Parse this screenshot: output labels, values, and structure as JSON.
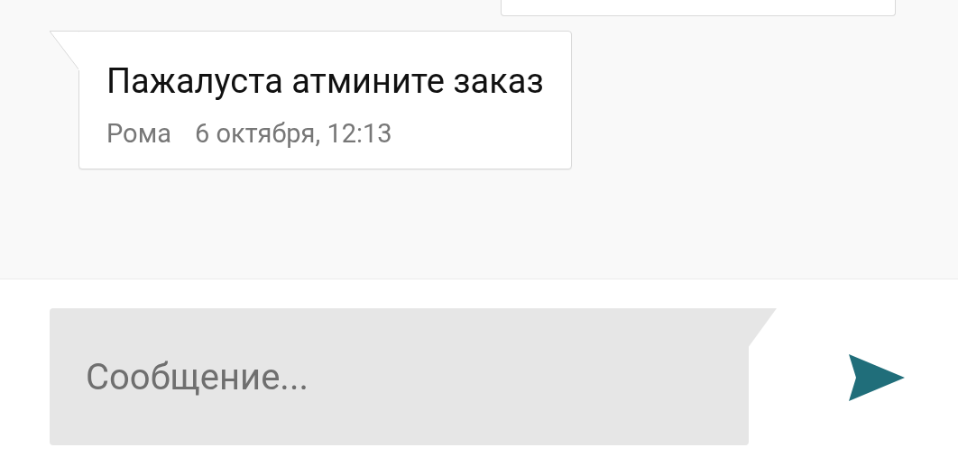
{
  "messages": [
    {
      "text": "Пажалуста атмините заказ",
      "author": "Рома",
      "time": "6 октября, 12:13"
    }
  ],
  "composer": {
    "placeholder": "Сообщение..."
  }
}
